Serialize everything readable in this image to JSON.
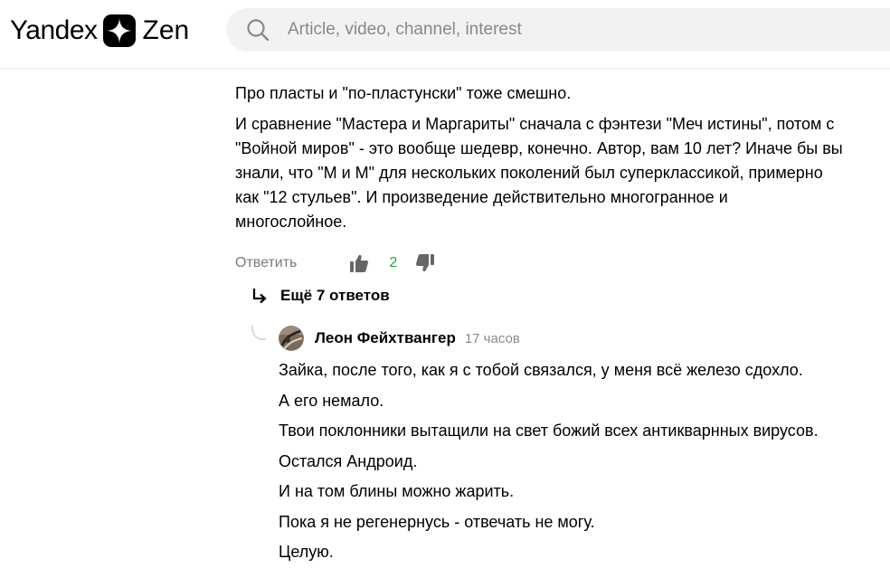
{
  "header": {
    "logo_yandex": "Yandex",
    "logo_zen": "Zen",
    "search_placeholder": "Article, video, channel, interest"
  },
  "comment": {
    "paragraphs": [
      "Про пласты и \"по-пластунски\" тоже смешно.",
      "И сравнение \"Мастера и Маргариты\" сначала с фэнтези \"Меч истины\", потом с",
      "\"Войной миров\" - это вообще шедевр, конечно. Автор, вам 10 лет? Иначе бы вы",
      "знали, что \"М и М\" для нескольких поколений был суперклассикой, примерно",
      "как \"12 стульев\". И произведение действительно многогранное и",
      "многослойное."
    ],
    "reply_label": "Ответить",
    "like_count": "2",
    "more_replies_label": "Ещё 7 ответов"
  },
  "reply": {
    "author": "Леон Фейхтвангер",
    "time": "17 часов",
    "lines": [
      "Зайка, после того, как я с тобой связался, у меня всё железо сдохло.",
      "А его немало.",
      "Твои поклонники вытащили на свет божий всех антикварнных вирусов.",
      "Остался Андроид.",
      "И на том блины можно жарить.",
      "Пока я не регенернусь - отвечать не могу.",
      "Целую."
    ]
  },
  "colors": {
    "like_count": "#22a53a",
    "muted_text": "#7a7a7a",
    "search_bg": "#f2f2f0"
  },
  "icons": [
    "zen-logo-icon",
    "search-icon",
    "thumb-up-icon",
    "thumb-down-icon",
    "reply-arrow-icon",
    "avatar"
  ]
}
